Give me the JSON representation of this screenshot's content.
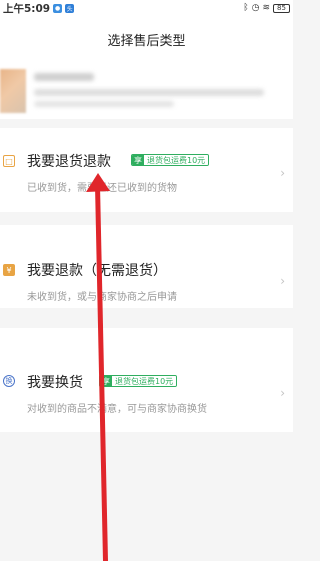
{
  "status_bar": {
    "time": "上午5:09",
    "app_icon_2_text": "头",
    "battery": "85",
    "icons": [
      "bluetooth-icon",
      "alarm-icon",
      "wifi-icon",
      "battery-icon"
    ]
  },
  "header": {
    "title": "选择售后类型"
  },
  "options": [
    {
      "icon": "box-icon",
      "title": "我要退货退款",
      "badge_prefix": "享",
      "badge_text": "退货包运费10元",
      "desc": "已收到货，需要退还已收到的货物"
    },
    {
      "icon": "money-icon",
      "title": "我要退款（无需退货）",
      "desc": "未收到货，或与商家协商之后申请"
    },
    {
      "icon": "exchange-icon",
      "title": "我要换货",
      "badge_prefix": "享",
      "badge_text": "退货包运费10元",
      "desc": "对收到的商品不满意，可与商家协商换货"
    }
  ],
  "colors": {
    "badge_green": "#2fae5f",
    "annotation_red": "#e0262b",
    "icon_orange": "#e8a444",
    "icon_blue": "#4a74c9"
  }
}
